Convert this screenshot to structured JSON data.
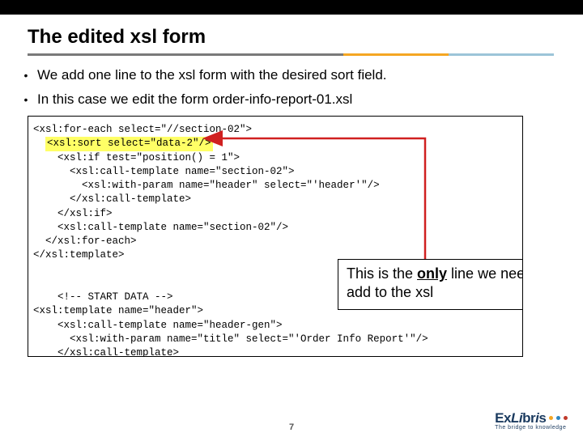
{
  "slide": {
    "title": "The edited xsl form",
    "bullets": [
      "We add one line to the xsl form with the desired sort field.",
      "In this case we edit the form order-info-report-01.xsl"
    ],
    "page_number": "7"
  },
  "code": {
    "lines": [
      "<xsl:for-each select=\"//section-02\">",
      "  <xsl:sort select=\"data-2\"/>",
      "    <xsl:if test=\"position()  = 1\">",
      "      <xsl:call-template name=\"section-02\">",
      "        <xsl:with-param name=\"header\" select=\"'header'\"/>",
      "      </xsl:call-template>",
      "    </xsl:if>",
      "    <xsl:call-template name=\"section-02\"/>",
      "  </xsl:for-each>",
      "</xsl:template>",
      "",
      "",
      "    <!-- START DATA -->",
      "<xsl:template name=\"header\">",
      "    <xsl:call-template name=\"header-gen\">",
      "      <xsl:with-param name=\"title\" select=\"'Order Info Report'\"/>",
      "    </xsl:call-template>"
    ],
    "highlighted_line_index": 1
  },
  "callout": {
    "prefix": "This is the ",
    "bold": "only",
    "suffix": " line we need to add to the xsl"
  },
  "branding": {
    "name": "ExLibris",
    "tagline": "The bridge to knowledge",
    "dot_colors": [
      "#f5a623",
      "#2e86c1",
      "#c0392b"
    ]
  }
}
